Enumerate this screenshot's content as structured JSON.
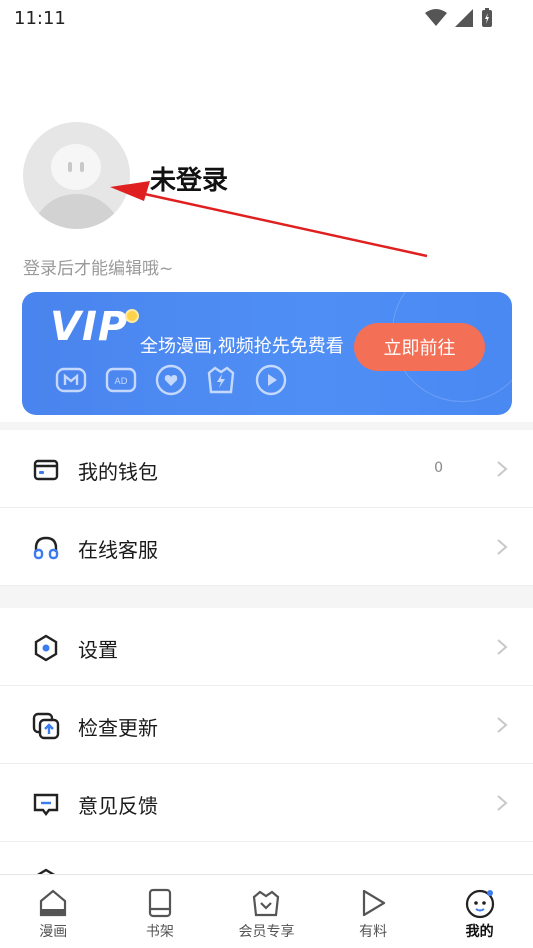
{
  "status_bar": {
    "time": "11:11"
  },
  "profile": {
    "username": "未登录",
    "login_hint": "登录后才能编辑哦~"
  },
  "vip": {
    "logo": "VIP",
    "promo_text": "全场漫画,视频抢先免费看",
    "cta_label": "立即前往",
    "accent_color": "#4a88f2",
    "cta_color": "#f36f55"
  },
  "menu_group_1": [
    {
      "label": "我的钱包",
      "icon": "wallet-icon",
      "count": "0"
    },
    {
      "label": "在线客服",
      "icon": "headset-icon"
    }
  ],
  "menu_group_2": [
    {
      "label": "设置",
      "icon": "settings-hexagon-icon"
    },
    {
      "label": "检查更新",
      "icon": "update-icon"
    },
    {
      "label": "意见反馈",
      "icon": "feedback-icon"
    }
  ],
  "bottom_nav": [
    {
      "label": "漫画",
      "icon": "home-icon"
    },
    {
      "label": "书架",
      "icon": "bookshelf-icon"
    },
    {
      "label": "会员专享",
      "icon": "crown-icon"
    },
    {
      "label": "有料",
      "icon": "play-icon"
    },
    {
      "label": "我的",
      "icon": "profile-face-icon",
      "active": true
    }
  ]
}
